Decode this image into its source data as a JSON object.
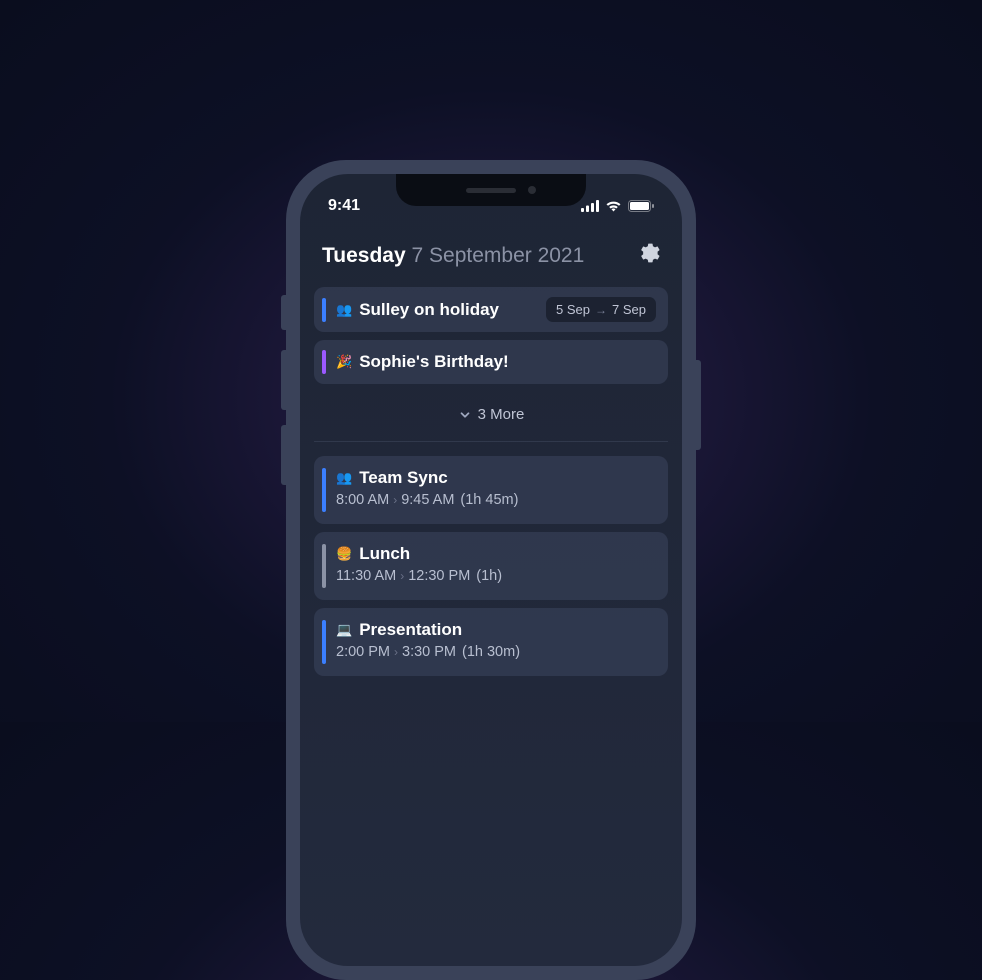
{
  "statusBar": {
    "time": "9:41"
  },
  "header": {
    "dayName": "Tuesday",
    "dateString": "7 September 2021"
  },
  "allDayEvents": [
    {
      "icon": "👥",
      "title": "Sulley on holiday",
      "color": "blue",
      "dateRange": {
        "from": "5 Sep",
        "to": "7 Sep"
      }
    },
    {
      "icon": "🎉",
      "title": "Sophie's Birthday!",
      "color": "purple"
    }
  ],
  "moreLabel": "3 More",
  "timedEvents": [
    {
      "icon": "👥",
      "title": "Team Sync",
      "color": "blue-tall",
      "start": "8:00 AM",
      "end": "9:45 AM",
      "duration": "(1h 45m)"
    },
    {
      "icon": "🍔",
      "title": "Lunch",
      "color": "gray-tall",
      "start": "11:30 AM",
      "end": "12:30 PM",
      "duration": "(1h)"
    },
    {
      "icon": "💻",
      "title": "Presentation",
      "color": "blue-tall",
      "start": "2:00 PM",
      "end": "3:30 PM",
      "duration": "(1h 30m)"
    }
  ]
}
